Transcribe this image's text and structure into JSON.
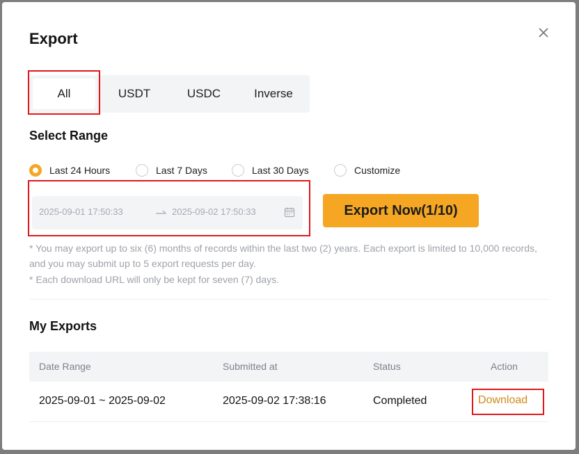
{
  "dialog": {
    "title": "Export"
  },
  "tabs": [
    {
      "label": "All",
      "active": true
    },
    {
      "label": "USDT",
      "active": false
    },
    {
      "label": "USDC",
      "active": false
    },
    {
      "label": "Inverse",
      "active": false
    }
  ],
  "range": {
    "label": "Select Range",
    "options": [
      {
        "label": "Last 24 Hours",
        "checked": true
      },
      {
        "label": "Last 7 Days",
        "checked": false
      },
      {
        "label": "Last 30 Days",
        "checked": false
      },
      {
        "label": "Customize",
        "checked": false
      }
    ],
    "start": "2025-09-01 17:50:33",
    "end": "2025-09-02 17:50:33"
  },
  "export_button": {
    "label": "Export Now(1/10)"
  },
  "notes": {
    "line1": "* You may export up to six (6) months of records within the last two (2) years. Each export is limited to 10,000 records, and you may submit up to 5 export requests per day.",
    "line2": "* Each download URL will only be kept for seven (7) days."
  },
  "my_exports": {
    "label": "My Exports",
    "columns": [
      "Date Range",
      "Submitted at",
      "Status",
      "Action"
    ],
    "rows": [
      {
        "date_range": "2025-09-01 ~ 2025-09-02",
        "submitted_at": "2025-09-02 17:38:16",
        "status": "Completed",
        "action": "Download"
      }
    ]
  },
  "colors": {
    "accent": "#f5a623",
    "link": "#d08a1a",
    "highlight": "#e0161b",
    "muted_text": "#9da1a8"
  },
  "icons": {
    "close": "close-icon",
    "arrow": "arrow-right-icon",
    "calendar": "calendar-icon"
  }
}
